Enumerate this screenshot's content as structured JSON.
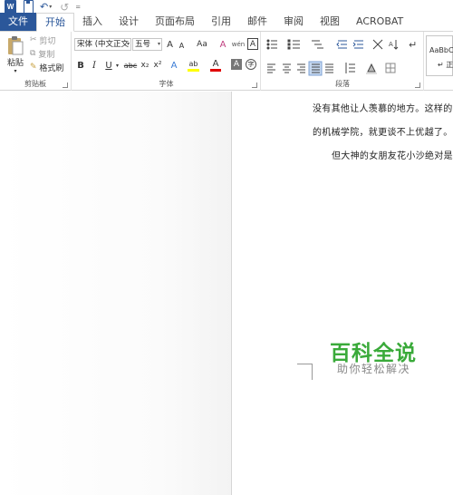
{
  "qat": {
    "logo": "W",
    "undo_glyph": "↶",
    "redo_glyph": "↺",
    "more_glyph": "=",
    "dropdown_glyph": "▾"
  },
  "tabs": [
    "文件",
    "开始",
    "插入",
    "设计",
    "页面布局",
    "引用",
    "邮件",
    "审阅",
    "视图",
    "ACROBAT"
  ],
  "clipboard": {
    "paste": "粘贴",
    "cut": "剪切",
    "copy": "复制",
    "format_painter": "格式刷",
    "label": "剪贴板"
  },
  "font": {
    "name": "宋体 (中文正文",
    "size": "五号",
    "grow": "A",
    "shrink": "A",
    "case": "Aa",
    "clear": "A",
    "phonetic": "wén",
    "border_char": "A",
    "bold": "B",
    "italic": "I",
    "underline": "U",
    "strike": "abc",
    "sub": "x₂",
    "sup": "x²",
    "effects": "A",
    "highlight": "ab",
    "font_color": "A",
    "shading": "A",
    "enclose": "字",
    "label": "字体"
  },
  "paragraph": {
    "label": "段落"
  },
  "styles": {
    "preview": "AaBbC",
    "name": "↵ 正"
  },
  "document": {
    "line1": "没有其他让人羡慕的地方。这样的",
    "line2": "的机械学院，就更谈不上优越了。",
    "line3": "但大神的女朋友花小沙绝对是"
  },
  "watermark": {
    "title": "百科全说",
    "subtitle": "助你轻松解决"
  },
  "colors": {
    "brand": "#2b579a",
    "watermark": "#3aaa3a",
    "highlight": "#ffff00",
    "font_red": "#e00000"
  }
}
